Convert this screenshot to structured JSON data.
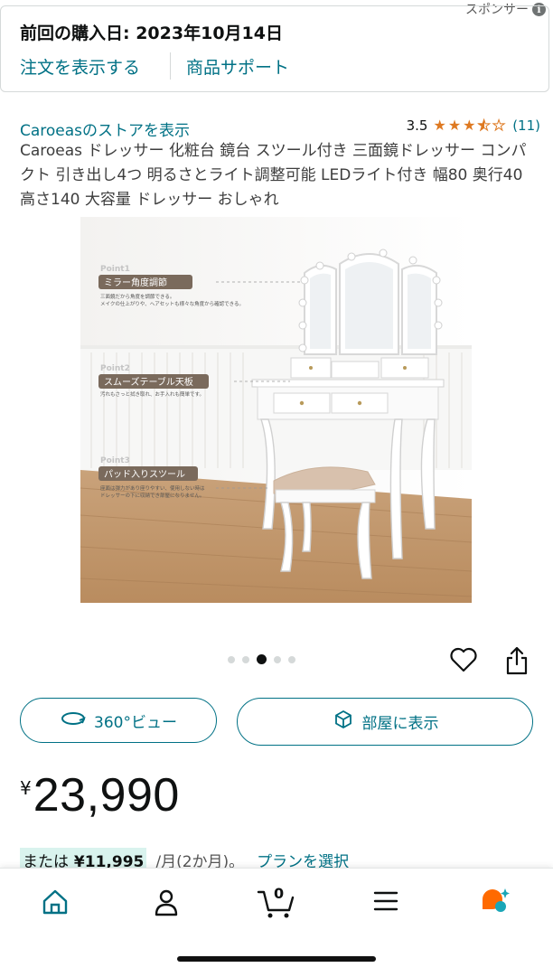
{
  "sponsor": {
    "label": "スポンサー",
    "info_glyph": "i"
  },
  "purchase": {
    "date_text": "前回の購入日: 2023年10月14日",
    "order_link": "注文を表示する",
    "support_link": "商品サポート"
  },
  "product": {
    "store_link": "Caroeasのストアを表示",
    "rating_value": "3.5",
    "rating_stars": 3.5,
    "rating_count": "(11)",
    "title": "Caroeas ドレッサー 化粧台 鏡台 スツール付き 三面鏡ドレッサー コンパクト 引き出し4つ 明るさとライト調整可能 LEDライト付き 幅80 奥行40 高さ140 大容量 ドレッサー おしゃれ"
  },
  "image_overlay": {
    "p1_tag": "Point1",
    "p1_title": "ミラー角度調節",
    "p1_line1": "三面鏡だから角度を調節できる。",
    "p1_line2": "メイクの仕上がりや、ヘアセットも様々な角度から確認できる。",
    "p2_tag": "Point2",
    "p2_title": "スムーズテーブル天板",
    "p2_line1": "汚れもさっと拭き取れ、お手入れも簡単です。",
    "p3_tag": "Point3",
    "p3_title": "パッド入りスツール",
    "p3_line1": "座面は弾力があり座りやすい、使用しない時は",
    "p3_line2": "ドレッサーの下に収納でき部屋になりません。"
  },
  "carousel": {
    "count": 5,
    "active_index": 2
  },
  "buttons": {
    "view360": "360°ビュー",
    "view_in_room": "部屋に表示"
  },
  "price": {
    "symbol": "¥",
    "amount": "23,990"
  },
  "installment": {
    "or": "または",
    "amount": "¥11,995",
    "per": "/月(2か月)。",
    "plan_link": "プランを選択"
  },
  "nav": {
    "items": [
      "home-icon",
      "account-icon",
      "cart-icon",
      "menu-icon",
      "rufus-icon"
    ],
    "cart_count": "0"
  },
  "colors": {
    "link": "#007185",
    "star": "#de7921",
    "accent_home": "#007185",
    "rufus_orange": "#ff6a00",
    "rufus_teal": "#1aa6b7"
  }
}
